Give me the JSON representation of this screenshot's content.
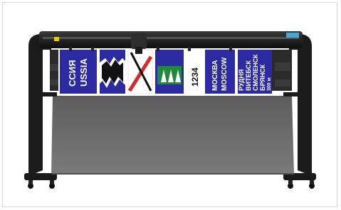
{
  "product": {
    "image_alt": "Wide-format cutting plotter on stand with printed road-sign vinyl",
    "sign_panel_1_text": [
      "ССИЯ",
      "USSIA"
    ],
    "sign_panel_number": "1234",
    "sign_panel_city": [
      "МОСКВА",
      "MOSCOW"
    ],
    "sign_panel_destinations": [
      "РУДНЯ",
      "ВИТЕБСК",
      "СМОЛЕНСК",
      "БРЯНСК"
    ],
    "sign_panel_distance": "300 м"
  },
  "colors": {
    "sign_blue": "#2b2aa0",
    "plotter_body": "#1e1e1e",
    "apron": "#6d6d6d",
    "accent_blue": "#49a7d6"
  }
}
